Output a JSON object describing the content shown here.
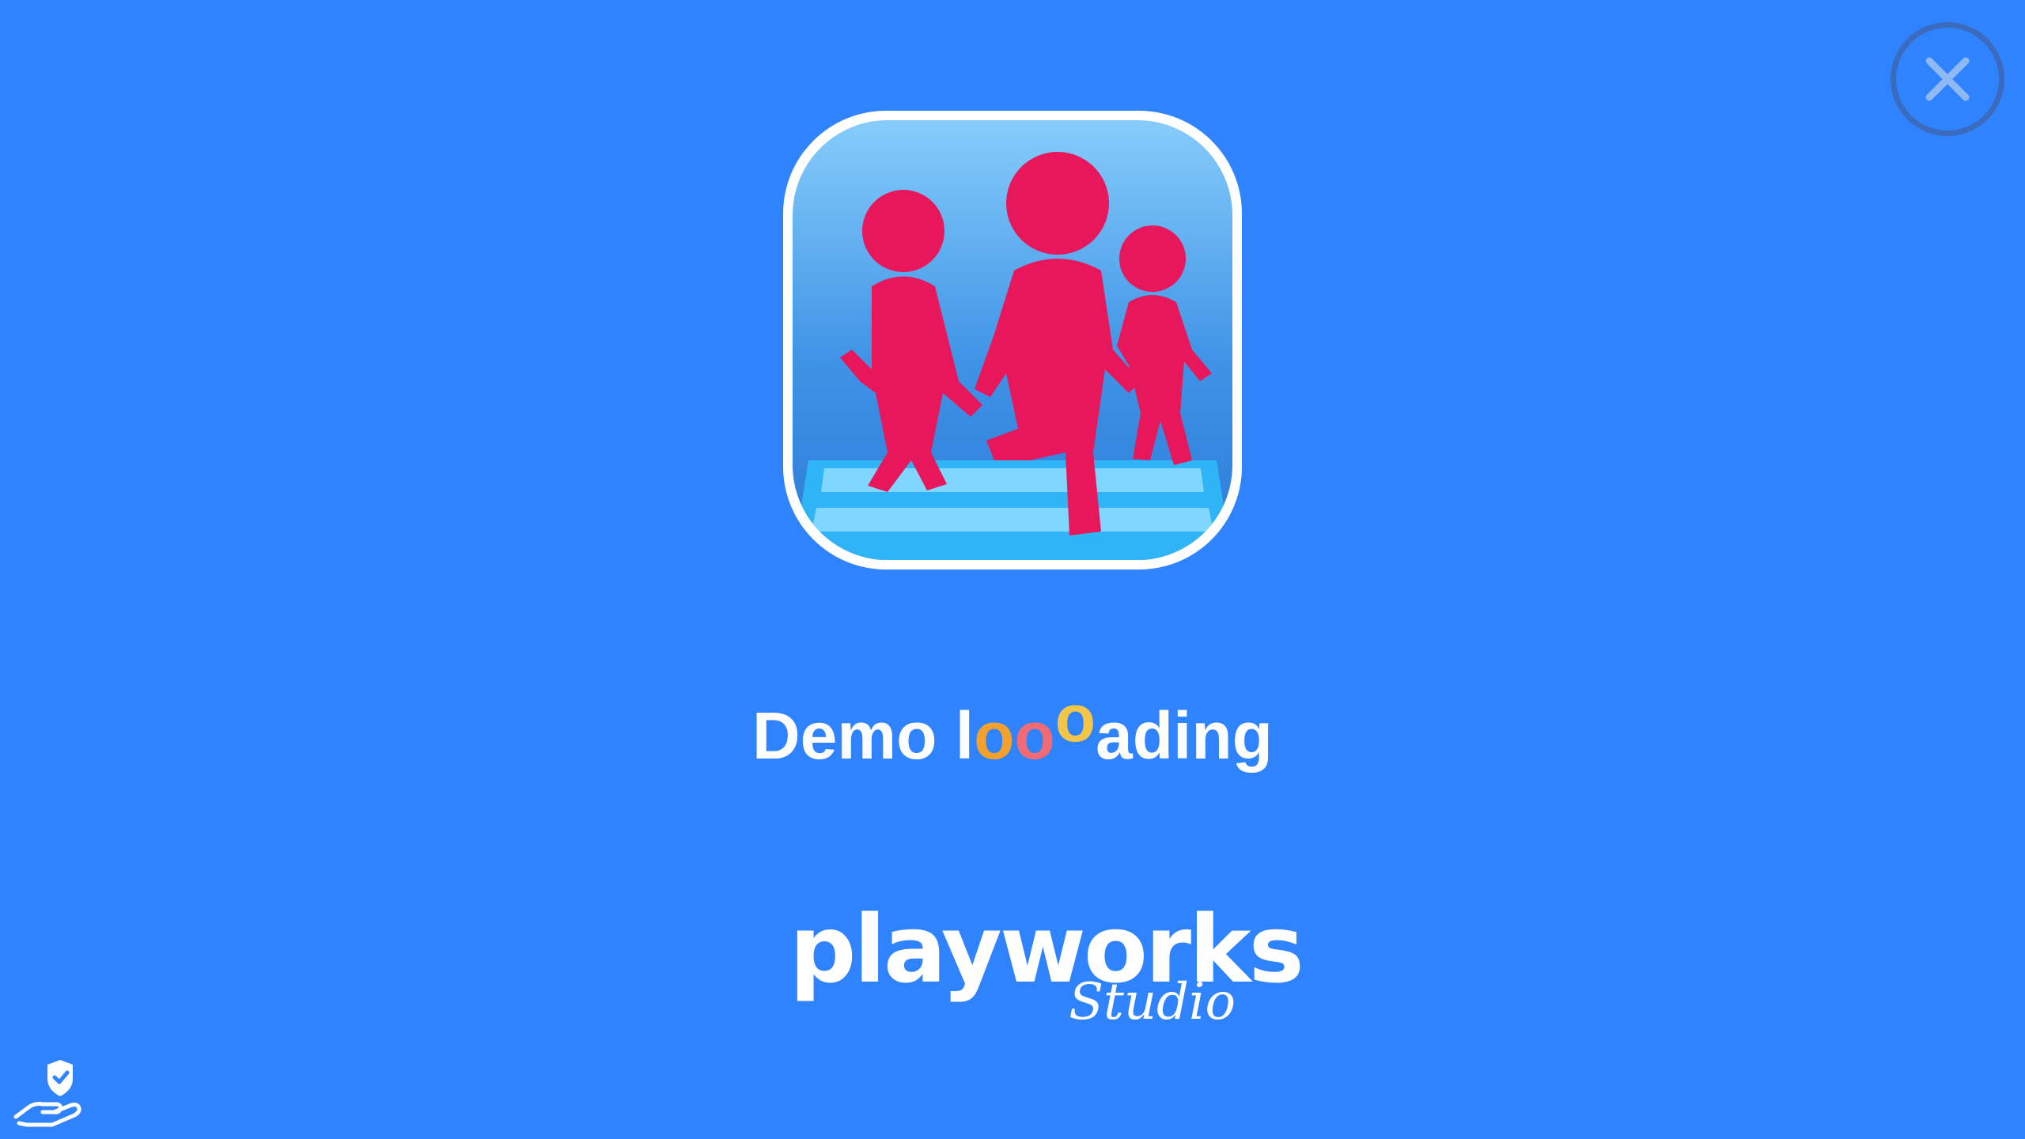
{
  "loading": {
    "prefix": "Demo l",
    "dots": [
      "o",
      "o",
      "o"
    ],
    "suffix": "ading"
  },
  "studio": {
    "wordmark": "playworks",
    "subword": "Studio"
  },
  "icons": {
    "close": "close-icon",
    "privacy": "privacy-hand-shield-icon",
    "app": "app-icon"
  },
  "colors": {
    "background": "#2f83ff",
    "close_ring": "#3b6bbf",
    "figure": "#e8175c",
    "dot_orange": "#f2a12e",
    "dot_pink": "#f06b73",
    "dot_yellow": "#f3c64a"
  }
}
